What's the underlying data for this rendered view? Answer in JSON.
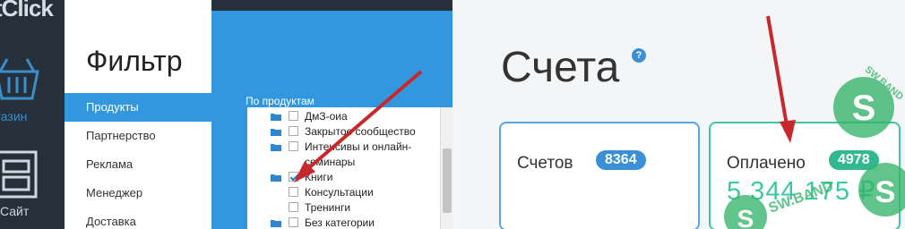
{
  "app": {
    "logo": "tClick",
    "sidebar": [
      {
        "label": "газин",
        "icon": "basket-icon"
      },
      {
        "label": "Сайт",
        "icon": "storefront-icon"
      }
    ]
  },
  "filter": {
    "title": "Фильтр",
    "menu": [
      "Продукты",
      "Партнерство",
      "Реклама",
      "Менеджер",
      "Доставка"
    ],
    "active_index": 0,
    "group_label": "По продуктам",
    "tree": [
      {
        "label": "ДмЗ-оиа",
        "folder": true,
        "checked": false
      },
      {
        "label": "Закрытое сообщество",
        "folder": true,
        "checked": false
      },
      {
        "label": "Интенсивы и онлайн-",
        "folder": true,
        "checked": false
      },
      {
        "label": "семинары",
        "folder": false,
        "checked": null
      },
      {
        "label": "Книги",
        "folder": true,
        "checked": true
      },
      {
        "label": "Консультации",
        "folder": false,
        "checked": false
      },
      {
        "label": "Тренинги",
        "folder": false,
        "checked": false
      },
      {
        "label": "Без категории",
        "folder": true,
        "checked": false
      }
    ]
  },
  "invoices": {
    "title": "Счета",
    "help": "?",
    "cards": [
      {
        "label": "Счетов",
        "badge": "8364",
        "amount": ""
      },
      {
        "label": "Оплачено",
        "badge": "4978",
        "amount": "5 344 175 ₽"
      }
    ]
  },
  "watermark": {
    "text": "SW.BAND"
  },
  "colors": {
    "accent_blue": "#3397dd",
    "dark_sidebar": "#25303b",
    "green": "#3ec7a4",
    "arrow_red": "#c8282b"
  }
}
